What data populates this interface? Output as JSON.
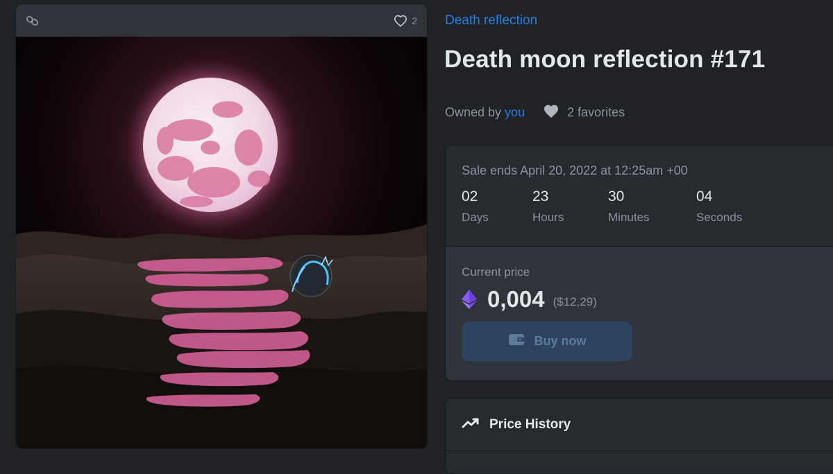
{
  "media": {
    "favorites_count": "2"
  },
  "collection": {
    "name": "Death reflection"
  },
  "item": {
    "title": "Death moon reflection #171"
  },
  "owner": {
    "prefix": "Owned by",
    "name": "you",
    "favorites": "2 favorites"
  },
  "sale": {
    "ends_text": "Sale ends April 20, 2022 at 12:25am +00",
    "countdown": [
      {
        "value": "02",
        "label": "Days"
      },
      {
        "value": "23",
        "label": "Hours"
      },
      {
        "value": "30",
        "label": "Minutes"
      },
      {
        "value": "04",
        "label": "Seconds"
      }
    ],
    "price_label": "Current price",
    "price_value": "0,004",
    "price_usd": "($12,29)",
    "buy_label": "Buy now"
  },
  "history": {
    "title": "Price History"
  },
  "colors": {
    "background": "#202225",
    "accent_link": "#2081e2",
    "card": "#262b2f",
    "buy_button": "#2d4461"
  },
  "icons": [
    "chain-icon",
    "heart-outline-icon",
    "heart-filled-icon",
    "eth-icon",
    "wallet-icon",
    "trending-up-icon"
  ]
}
